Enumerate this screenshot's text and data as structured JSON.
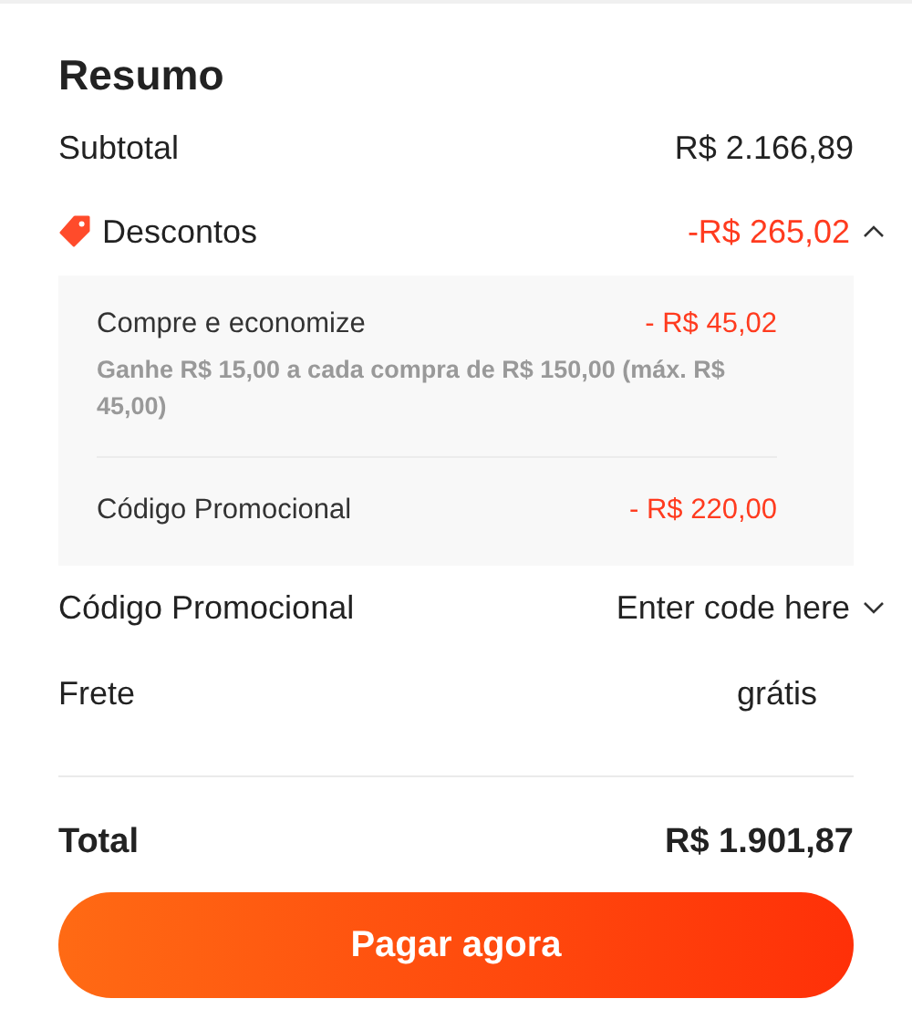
{
  "title": "Resumo",
  "subtotal": {
    "label": "Subtotal",
    "value": "R$ 2.166,89"
  },
  "discounts": {
    "label": "Descontos",
    "value": "-R$ 265,02",
    "expanded": true,
    "items": [
      {
        "label": "Compre e economize",
        "value": "- R$ 45,02",
        "note": "Ganhe R$ 15,00 a cada compra de R$ 150,00 (máx. R$ 45,00)"
      },
      {
        "label": "Código Promocional",
        "value": "- R$ 220,00"
      }
    ]
  },
  "promo_code": {
    "label": "Código Promocional",
    "placeholder": "Enter code here",
    "expanded": false
  },
  "shipping": {
    "label": "Frete",
    "value": "grátis"
  },
  "total": {
    "label": "Total",
    "value": "R$ 1.901,87"
  },
  "pay_button": "Pagar agora"
}
